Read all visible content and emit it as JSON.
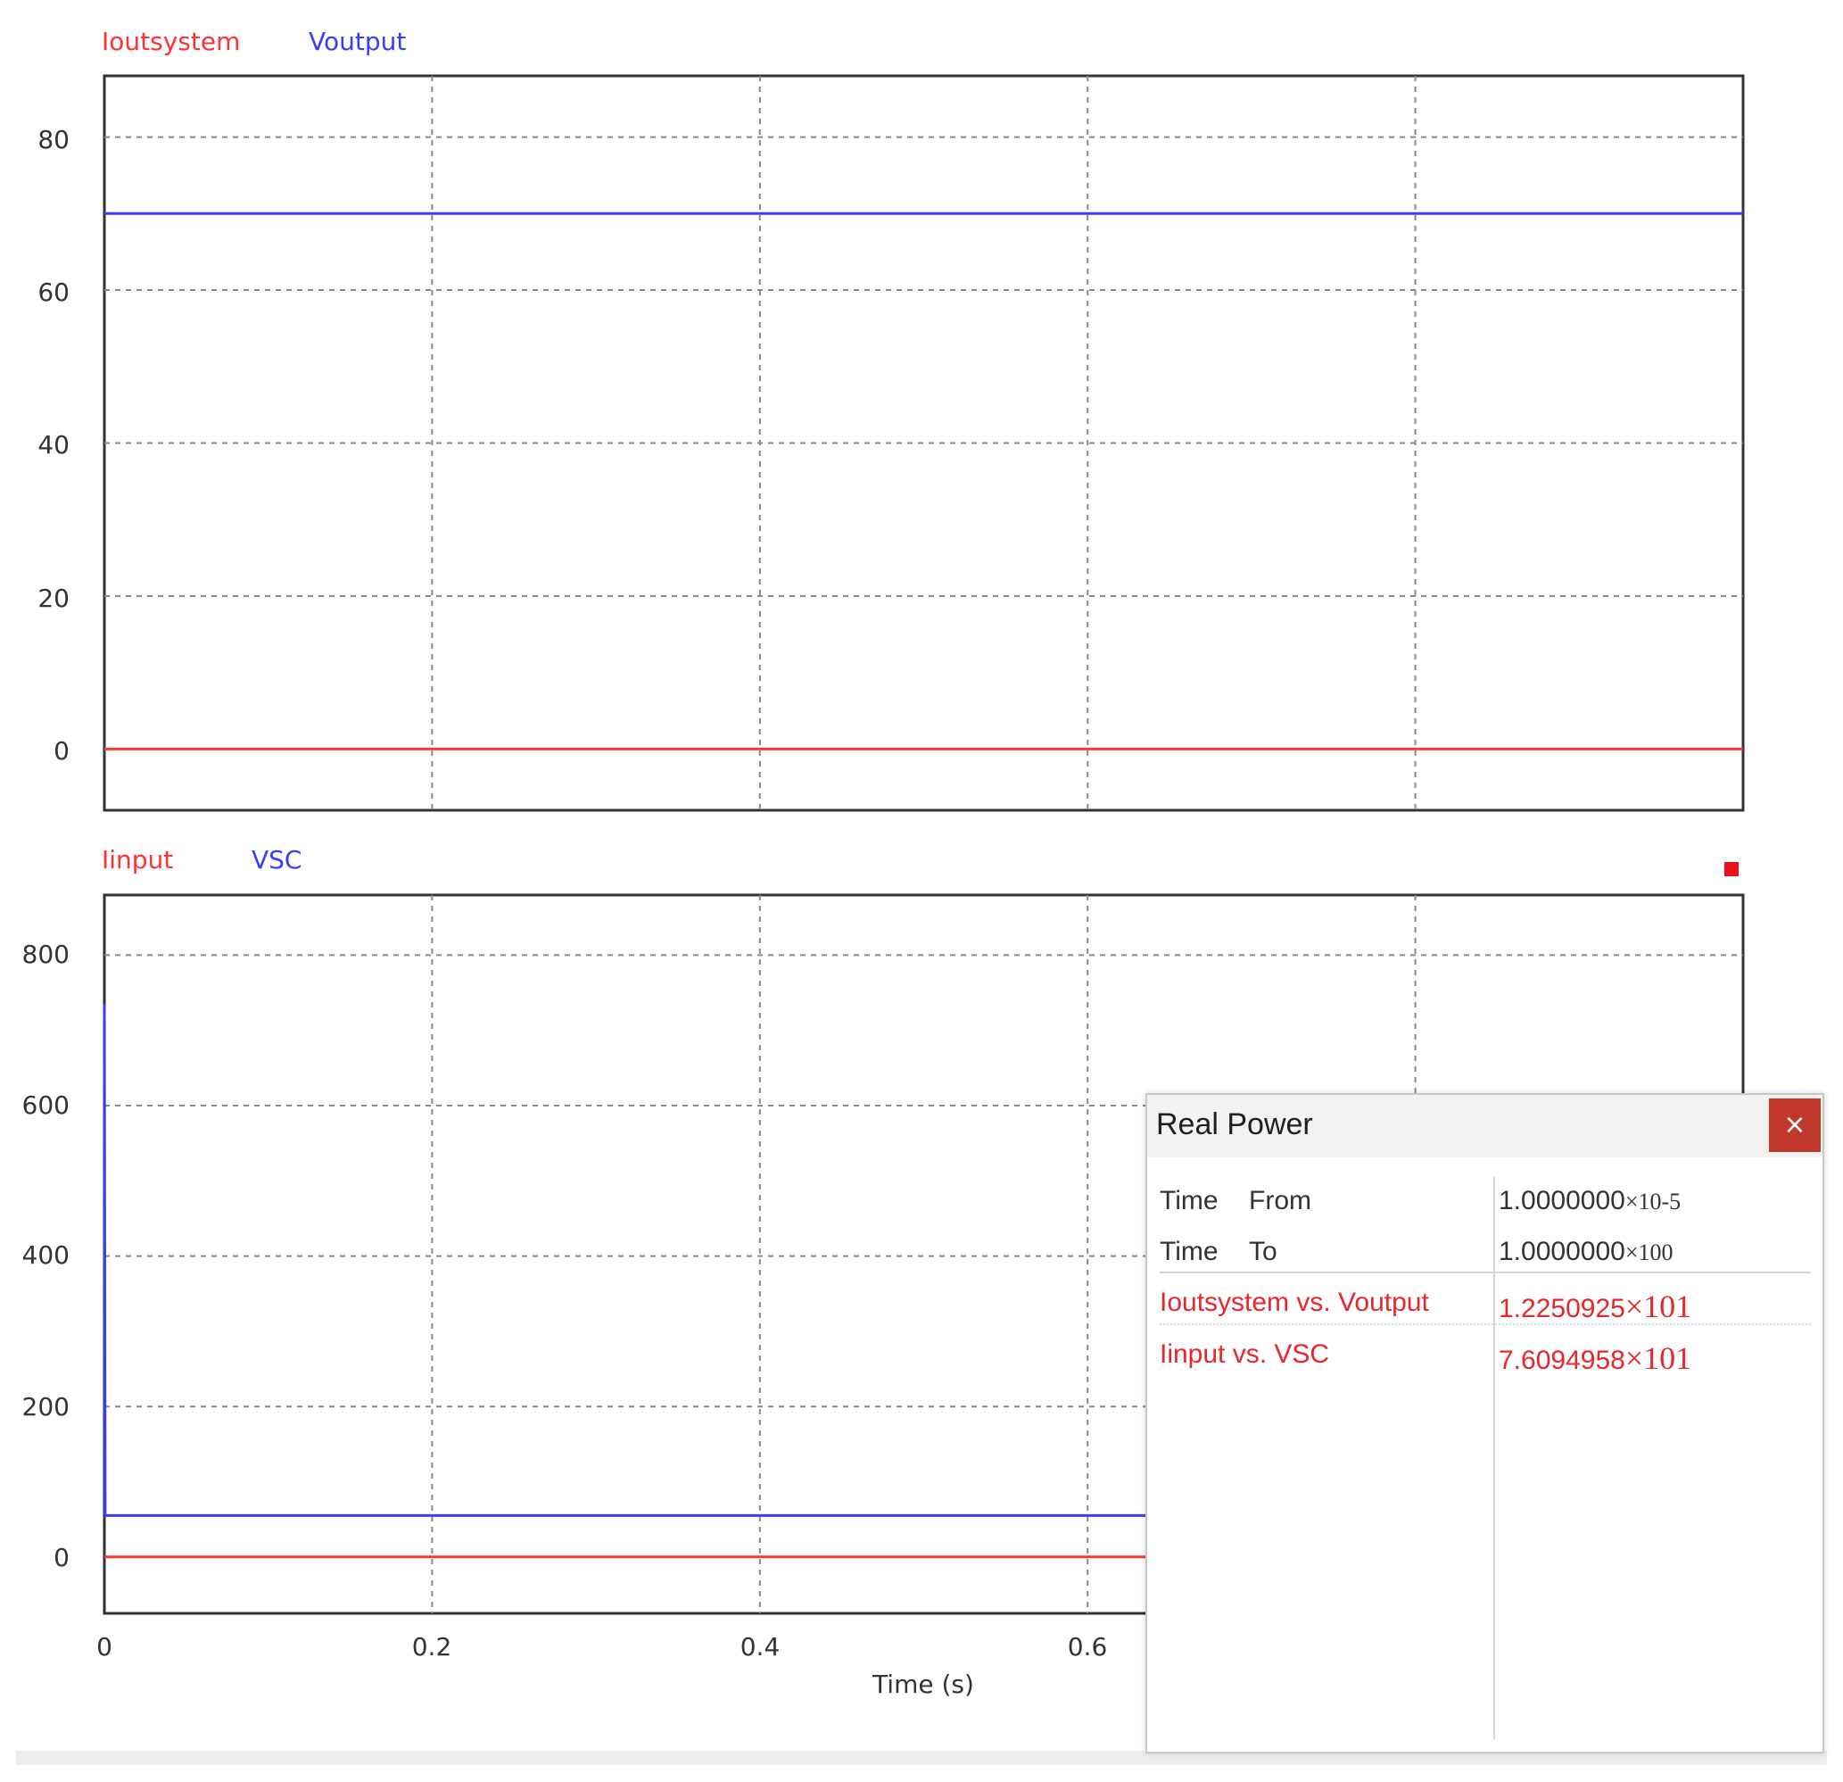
{
  "plots": [
    {
      "legend": [
        {
          "label": "Ioutsystem",
          "color": "#ff3333"
        },
        {
          "label": "Voutput",
          "color": "#3b3bff"
        }
      ],
      "yticks": [
        "80",
        "60",
        "40",
        "20",
        "0"
      ]
    },
    {
      "legend": [
        {
          "label": "Iinput",
          "color": "#ff3333"
        },
        {
          "label": "VSC",
          "color": "#3b3bff"
        }
      ],
      "yticks": [
        "800",
        "600",
        "400",
        "200",
        "0"
      ]
    }
  ],
  "xaxis": {
    "ticks": [
      "0",
      "0.2",
      "0.4",
      "0.6"
    ],
    "label": "Time (s)"
  },
  "dialog": {
    "title": "Real Power",
    "close_label": "×",
    "rows": [
      {
        "col1": "Time",
        "col2": "From",
        "mantissa": "1.0000000",
        "exp": "×10-5"
      },
      {
        "col1": "Time",
        "col2": "To",
        "mantissa": "1.0000000",
        "exp": "×100"
      },
      {
        "label": "Ioutsystem vs. Voutput",
        "mantissa": "1.2250925",
        "exp": "×101"
      },
      {
        "label": "Iinput vs. VSC",
        "mantissa": "7.6094958",
        "exp": "×101"
      }
    ]
  },
  "colors": {
    "current": "#ff3333",
    "voltage": "#3b3bff",
    "marker": "#e8101a",
    "close_button": "#c0392b"
  },
  "chart_data": [
    {
      "type": "line",
      "x": [
        0,
        1.0
      ],
      "xlim": [
        0,
        1.0
      ],
      "ylim": [
        -8,
        88
      ],
      "series": [
        {
          "name": "Ioutsystem",
          "y": [
            0,
            0
          ]
        },
        {
          "name": "Voutput",
          "y": [
            70,
            70
          ]
        }
      ],
      "grid": true
    },
    {
      "type": "line",
      "xlim": [
        0,
        1.0
      ],
      "ylim": [
        -75,
        880
      ],
      "series": [
        {
          "name": "Iinput",
          "x": [
            0,
            1.0
          ],
          "y": [
            0,
            0
          ]
        },
        {
          "name": "VSC",
          "x": [
            0,
            0,
            0.0005,
            1.0
          ],
          "y": [
            735,
            735,
            55,
            55
          ]
        }
      ],
      "grid": true
    }
  ]
}
